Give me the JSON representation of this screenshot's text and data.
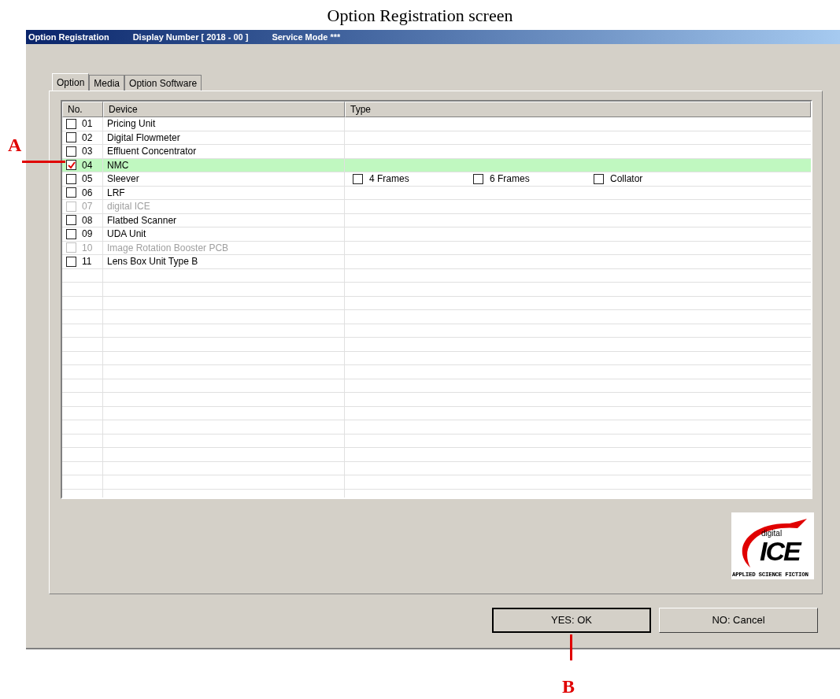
{
  "caption": "Option Registration screen",
  "window": {
    "title": "Option Registration",
    "display_number": "Display Number [ 2018 - 00 ]",
    "service_mode": "Service Mode ***"
  },
  "tabs": [
    {
      "label": "Option",
      "selected": true
    },
    {
      "label": "Media",
      "selected": false
    },
    {
      "label": "Option Software",
      "selected": false
    }
  ],
  "table": {
    "columns": [
      "No.",
      "Device",
      "Type"
    ],
    "rows": [
      {
        "no": "01",
        "device": "Pricing Unit",
        "checked": false,
        "disabled": false,
        "selected": false
      },
      {
        "no": "02",
        "device": "Digital Flowmeter",
        "checked": false,
        "disabled": false,
        "selected": false
      },
      {
        "no": "03",
        "device": "Effluent Concentrator",
        "checked": false,
        "disabled": false,
        "selected": false
      },
      {
        "no": "04",
        "device": "NMC",
        "checked": true,
        "disabled": false,
        "selected": true
      },
      {
        "no": "05",
        "device": "Sleever",
        "checked": false,
        "disabled": false,
        "selected": false,
        "types": [
          {
            "label": "4 Frames",
            "checked": false
          },
          {
            "label": "6 Frames",
            "checked": false
          },
          {
            "label": "Collator",
            "checked": false
          }
        ]
      },
      {
        "no": "06",
        "device": "LRF",
        "checked": false,
        "disabled": false,
        "selected": false
      },
      {
        "no": "07",
        "device": "digital ICE",
        "checked": false,
        "disabled": true,
        "selected": false
      },
      {
        "no": "08",
        "device": "Flatbed Scanner",
        "checked": false,
        "disabled": false,
        "selected": false
      },
      {
        "no": "09",
        "device": "UDA Unit",
        "checked": false,
        "disabled": false,
        "selected": false
      },
      {
        "no": "10",
        "device": "Image Rotation Booster PCB",
        "checked": false,
        "disabled": true,
        "selected": false
      },
      {
        "no": "11",
        "device": "Lens Box Unit Type B",
        "checked": false,
        "disabled": false,
        "selected": false
      }
    ]
  },
  "logo": {
    "small": "digital",
    "big": "ICE",
    "tagline": "APPLIED SCIENCE FICTION"
  },
  "buttons": [
    {
      "label": "YES: OK",
      "default": true
    },
    {
      "label": "NO: Cancel",
      "default": false
    }
  ],
  "annotations": [
    {
      "label": "A"
    },
    {
      "label": "B"
    }
  ]
}
